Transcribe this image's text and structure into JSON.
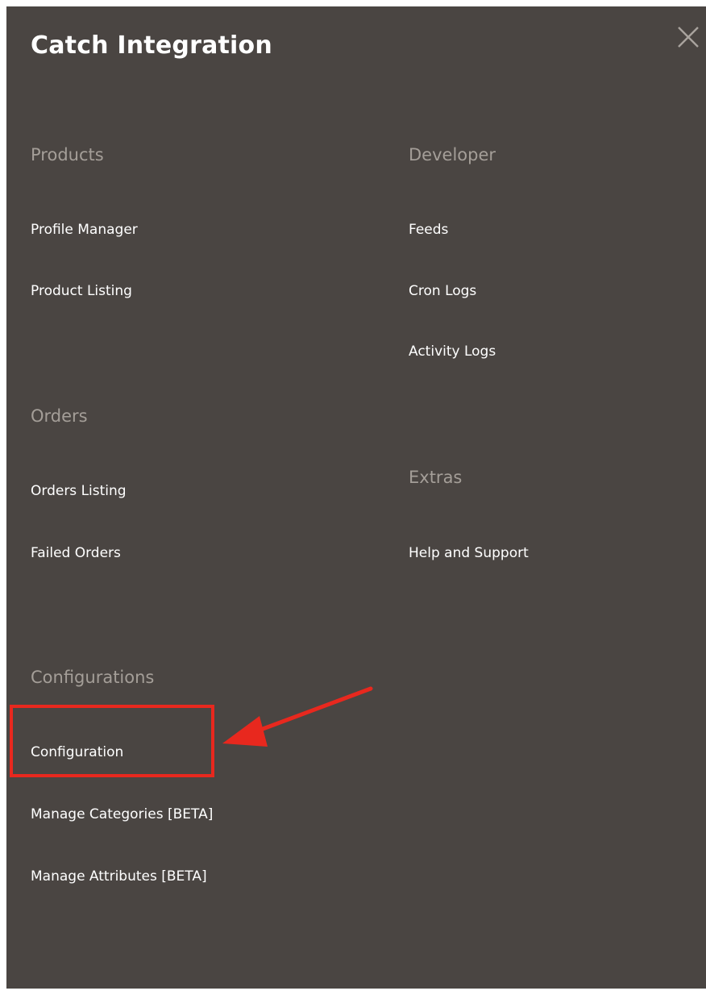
{
  "menu": {
    "title": "Catch Integration",
    "close_icon": "close-icon",
    "sections": {
      "products": {
        "heading": "Products",
        "items": [
          "Profile Manager",
          "Product Listing"
        ]
      },
      "orders": {
        "heading": "Orders",
        "items": [
          "Orders Listing",
          "Failed Orders"
        ]
      },
      "configurations": {
        "heading": "Configurations",
        "items": [
          "Configuration",
          "Manage Categories [BETA]",
          "Manage Attributes [BETA]"
        ]
      },
      "developer": {
        "heading": "Developer",
        "items": [
          "Feeds",
          "Cron Logs",
          "Activity Logs"
        ]
      },
      "extras": {
        "heading": "Extras",
        "items": [
          "Help and Support"
        ]
      }
    }
  },
  "annotation": {
    "highlight_color": "#e8281e",
    "target": "Configuration"
  },
  "colors": {
    "panel_background": "#4a4542",
    "heading": "#a49e98",
    "item": "#ffffff"
  }
}
